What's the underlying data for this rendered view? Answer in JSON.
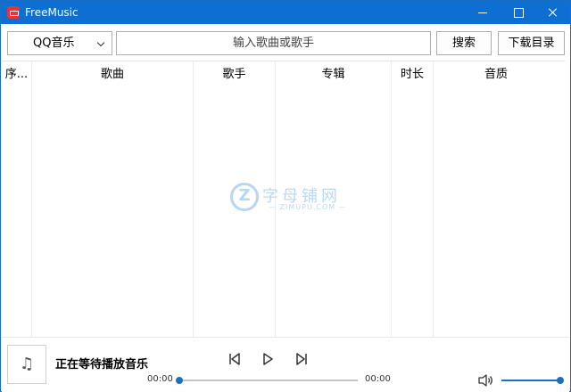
{
  "window": {
    "title": "FreeMusic",
    "accent_color": "#0c6fd1",
    "controls": [
      "minimize-icon",
      "maximize-icon",
      "close-icon"
    ]
  },
  "toolbar": {
    "source": {
      "selected": "QQ音乐",
      "icon": "chevron-down-icon"
    },
    "search": {
      "placeholder": "输入歌曲或歌手",
      "value": ""
    },
    "search_label": "搜索",
    "download_label": "下载目录"
  },
  "table": {
    "columns": [
      "序号",
      "歌曲",
      "歌手",
      "专辑",
      "时长",
      "音质"
    ],
    "columns_display": [
      "序...",
      "歌曲",
      "歌手",
      "专辑",
      "时长",
      "音质"
    ],
    "rows": []
  },
  "watermark": {
    "text": "字母铺网",
    "subtext": "— ZIMUPU.COM —"
  },
  "player": {
    "cover_icon": "music-note-icon",
    "status": "正在等待播放音乐",
    "current_time": "00:00",
    "total_time": "00:00",
    "progress": 0,
    "volume": 1.0,
    "controls": [
      "previous-icon",
      "play-icon",
      "next-icon"
    ],
    "volume_icon": "volume-icon"
  }
}
